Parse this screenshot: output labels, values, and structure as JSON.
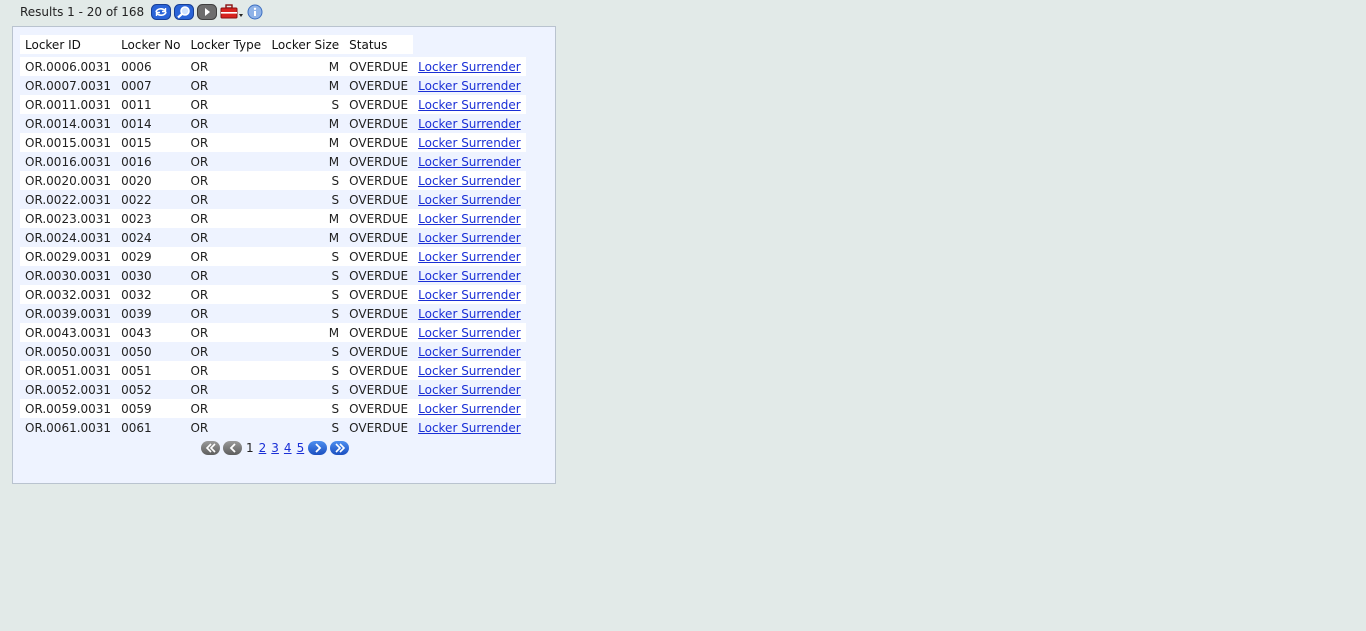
{
  "toolbar": {
    "results_text": "Results 1 - 20 of 168",
    "icons": [
      "refresh-icon",
      "search-icon",
      "play-icon",
      "toolbox-icon",
      "info-icon"
    ]
  },
  "table": {
    "headers": [
      "Locker ID",
      "Locker No",
      "Locker Type",
      "Locker Size",
      "Status"
    ],
    "action_label": "Locker Surrender",
    "rows": [
      {
        "id": "OR.0006.0031",
        "no": "0006",
        "type": "OR",
        "size": "M",
        "status": "OVERDUE"
      },
      {
        "id": "OR.0007.0031",
        "no": "0007",
        "type": "OR",
        "size": "M",
        "status": "OVERDUE"
      },
      {
        "id": "OR.0011.0031",
        "no": "0011",
        "type": "OR",
        "size": "S",
        "status": "OVERDUE"
      },
      {
        "id": "OR.0014.0031",
        "no": "0014",
        "type": "OR",
        "size": "M",
        "status": "OVERDUE"
      },
      {
        "id": "OR.0015.0031",
        "no": "0015",
        "type": "OR",
        "size": "M",
        "status": "OVERDUE"
      },
      {
        "id": "OR.0016.0031",
        "no": "0016",
        "type": "OR",
        "size": "M",
        "status": "OVERDUE"
      },
      {
        "id": "OR.0020.0031",
        "no": "0020",
        "type": "OR",
        "size": "S",
        "status": "OVERDUE"
      },
      {
        "id": "OR.0022.0031",
        "no": "0022",
        "type": "OR",
        "size": "S",
        "status": "OVERDUE"
      },
      {
        "id": "OR.0023.0031",
        "no": "0023",
        "type": "OR",
        "size": "M",
        "status": "OVERDUE"
      },
      {
        "id": "OR.0024.0031",
        "no": "0024",
        "type": "OR",
        "size": "M",
        "status": "OVERDUE"
      },
      {
        "id": "OR.0029.0031",
        "no": "0029",
        "type": "OR",
        "size": "S",
        "status": "OVERDUE"
      },
      {
        "id": "OR.0030.0031",
        "no": "0030",
        "type": "OR",
        "size": "S",
        "status": "OVERDUE"
      },
      {
        "id": "OR.0032.0031",
        "no": "0032",
        "type": "OR",
        "size": "S",
        "status": "OVERDUE"
      },
      {
        "id": "OR.0039.0031",
        "no": "0039",
        "type": "OR",
        "size": "S",
        "status": "OVERDUE"
      },
      {
        "id": "OR.0043.0031",
        "no": "0043",
        "type": "OR",
        "size": "M",
        "status": "OVERDUE"
      },
      {
        "id": "OR.0050.0031",
        "no": "0050",
        "type": "OR",
        "size": "S",
        "status": "OVERDUE"
      },
      {
        "id": "OR.0051.0031",
        "no": "0051",
        "type": "OR",
        "size": "S",
        "status": "OVERDUE"
      },
      {
        "id": "OR.0052.0031",
        "no": "0052",
        "type": "OR",
        "size": "S",
        "status": "OVERDUE"
      },
      {
        "id": "OR.0059.0031",
        "no": "0059",
        "type": "OR",
        "size": "S",
        "status": "OVERDUE"
      },
      {
        "id": "OR.0061.0031",
        "no": "0061",
        "type": "OR",
        "size": "S",
        "status": "OVERDUE"
      }
    ]
  },
  "pagination": {
    "current": "1",
    "pages": [
      "2",
      "3",
      "4",
      "5"
    ],
    "icons": [
      "first-page-icon",
      "prev-page-icon",
      "next-page-icon",
      "last-page-icon"
    ]
  },
  "colors": {
    "page_bg": "#e2eae8",
    "panel_bg": "#eef3ff",
    "link": "#1a2fd6"
  }
}
